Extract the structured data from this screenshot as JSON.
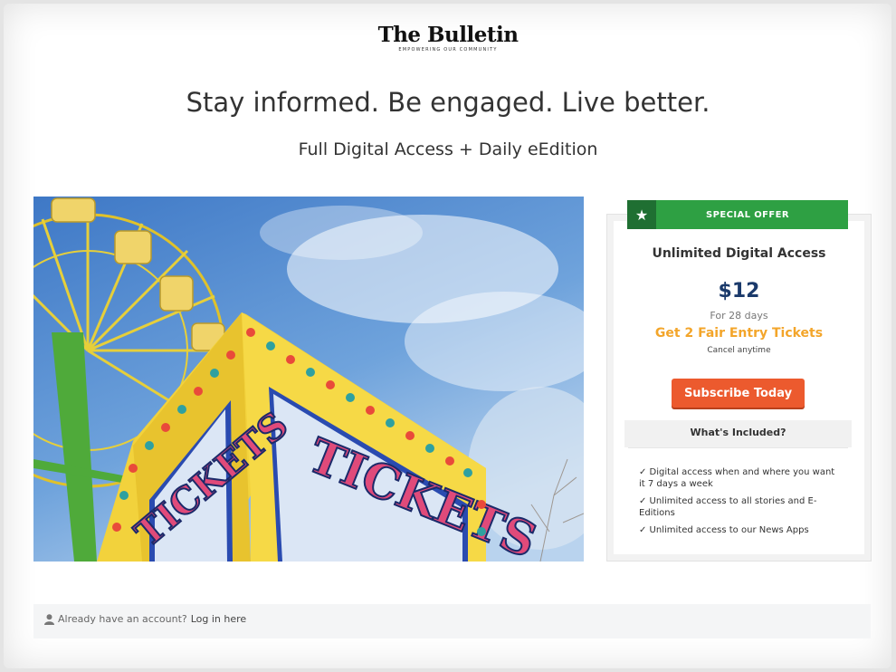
{
  "logo": {
    "name": "The Bulletin",
    "tagline": "EMPOWERING OUR COMMUNITY"
  },
  "headline": "Stay informed. Be engaged. Live better.",
  "subhead": "Full Digital Access + Daily eEdition",
  "offer": {
    "badge_icon": "star-icon",
    "badge_label": "SPECIAL OFFER",
    "plan_title": "Unlimited Digital Access",
    "price": "$12",
    "period": "For 28 days",
    "promo": "Get 2 Fair Entry Tickets",
    "cancel_note": "Cancel anytime",
    "button_label": "Subscribe Today"
  },
  "included": {
    "heading": "What's Included?",
    "features": [
      "✓ Digital access when and where you want it 7 days a week",
      "✓ Unlimited access to all stories and E-Editions",
      "✓ Unlimited access to our News Apps"
    ]
  },
  "login": {
    "icon": "user-icon",
    "prompt": "Already have an account?",
    "link": "Log in here"
  },
  "hero_image": {
    "sign_text": "TICKETS"
  },
  "colors": {
    "offer_green": "#2ea043",
    "price_navy": "#1b3a6b",
    "promo_orange": "#f3a52a",
    "button_orange": "#ec5a2e"
  }
}
